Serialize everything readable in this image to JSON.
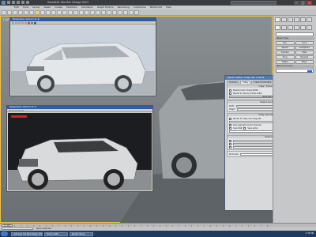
{
  "title": "Autodesk 3ds Max Design 2013",
  "menu": [
    "Edit",
    "Tools",
    "Group",
    "Views",
    "Create",
    "Modifiers",
    "Animation",
    "Graph Editors",
    "Rendering",
    "Customize",
    "MAXScript",
    "Help"
  ],
  "viewport": {
    "label": "[+][Perspective][Realistic]"
  },
  "render_window_top": {
    "title": "Perspective, frame 0 (1:1)"
  },
  "render_window_bottom": {
    "title": "Perspective, frame 0 (1:1)"
  },
  "dialog": {
    "title": "Render Setup: V-Ray Adv 2.30.01",
    "tabs": [
      "Common",
      "V-Ray",
      "Indirect illumination",
      "Settings",
      "Render Elements"
    ],
    "section_frame_buffer": "V-Ray:: Frame buffer",
    "rows_fb": [
      "Enable built-in Frame Buffer",
      "Render to memory frame buffer",
      "Show last VFB"
    ],
    "section_resolution": "Output resolution",
    "width_label": "Width",
    "height_label": "Height",
    "section_image": "V-Ray raw image file",
    "render_to_file": "Render to V-Ray raw image file",
    "split_channels": "Save separate render channels",
    "save_rgb": "Save RGB",
    "save_alpha": "Save alpha",
    "section_options": "Options",
    "render_btn": "Render",
    "production": "Production"
  },
  "cmdpanel": {
    "rollout1": "Object Type",
    "buttons": [
      "Box",
      "Cone",
      "Sphere",
      "GeoSphere",
      "Cylinder",
      "Tube",
      "Torus",
      "Pyramid",
      "Teapot",
      "Plane"
    ],
    "rollout2": "Name and Color"
  },
  "timeline": {
    "frame": "0 / 100"
  },
  "status": {
    "text": "None Selected"
  },
  "taskbar": {
    "items": [
      "Autodesk 3ds Max Design 2013",
      "Frame buffer",
      "Render Setup"
    ],
    "clock": "1:36 PM"
  }
}
